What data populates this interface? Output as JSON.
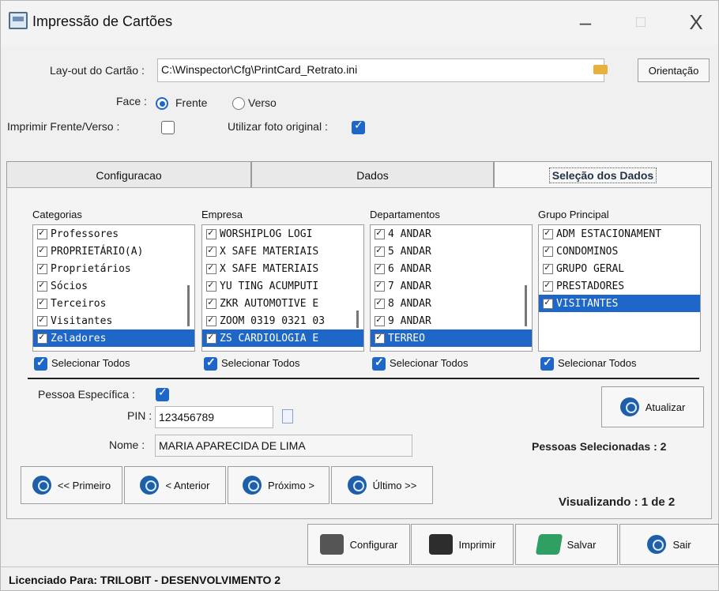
{
  "window": {
    "title": "Impressão de Cartões",
    "controls": [
      "–",
      "□",
      "X"
    ]
  },
  "top": {
    "layout_label": "Lay-out do Cartão :",
    "layout_value": "C:\\Winspector\\Cfg\\PrintCard_Retrato.ini",
    "orientation_btn": "Orientação",
    "face_label": "Face :",
    "face_options": [
      "Frente",
      "Verso"
    ],
    "face_selected": "Frente",
    "print_both_label": "Imprimir Frente/Verso :",
    "use_original_label": "Utilizar foto original :"
  },
  "tabs": [
    "Configuracao",
    "Dados",
    "Seleção dos Dados"
  ],
  "columns": [
    {
      "title": "Categorias",
      "items": [
        "Professores",
        "PROPRIETÁRIO(A)",
        "Proprietários",
        "Sócios",
        "Terceiros",
        "Visitantes",
        "Zeladores"
      ],
      "selected_index": 6
    },
    {
      "title": "Empresa",
      "items": [
        "WORSHIPLOG LOGI",
        "X SAFE MATERIAIS",
        "X SAFE MATERIAIS",
        "YU TING ACUMPUTI",
        "ZKR AUTOMOTIVE E",
        "ZOOM 0319 0321 03",
        "ZS CARDIOLOGIA E"
      ],
      "selected_index": 6
    },
    {
      "title": "Departamentos",
      "items": [
        "4 ANDAR",
        "5 ANDAR",
        "6 ANDAR",
        "7 ANDAR",
        "8 ANDAR",
        "9 ANDAR",
        "TERREO"
      ],
      "selected_index": 6
    },
    {
      "title": "Grupo Principal",
      "items": [
        "ADM ESTACIONAMENT",
        "CONDOMINOS",
        "GRUPO GERAL",
        "PRESTADORES",
        "VISITANTES"
      ],
      "selected_index": 4
    }
  ],
  "select_all_label": "Selecionar Todos",
  "person": {
    "specific_label": "Pessoa Específica :",
    "pin_label": "PIN :",
    "pin_value": "123456789",
    "name_label": "Nome :",
    "name_value": "MARIA APARECIDA DE LIMA"
  },
  "actions": {
    "update_btn": "Atualizar",
    "selected_count": "Pessoas Selecionadas : 2",
    "viewing": "Visualizando : 1 de 2",
    "nav": [
      "<< Primeiro",
      "< Anterior",
      "Próximo >",
      "Último >>"
    ],
    "bottom": [
      "Configurar",
      "Imprimir",
      "Salvar",
      "Sair"
    ]
  },
  "footer": "Licenciado Para: TRILOBIT - DESENVOLVIMENTO 2"
}
